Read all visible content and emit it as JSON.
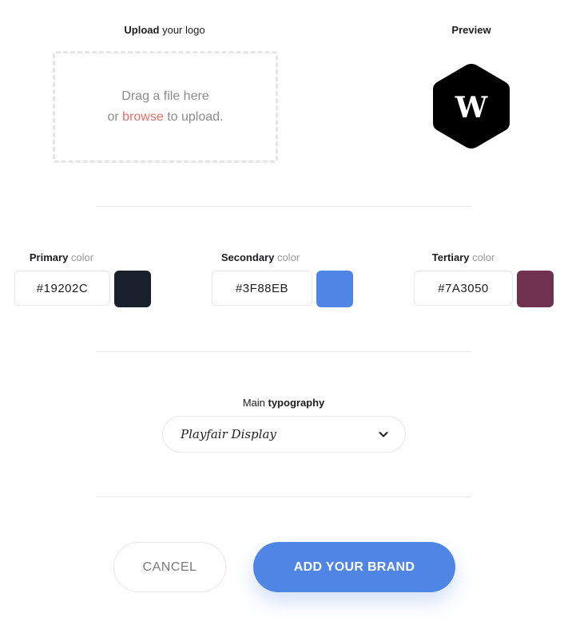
{
  "upload": {
    "title_bold": "Upload",
    "title_rest": " your logo",
    "drop_line1": "Drag a file here",
    "drop_or": "or ",
    "drop_browse": "browse",
    "drop_tail": " to upload."
  },
  "preview": {
    "title": "Preview",
    "logo_letter": "W",
    "logo_icon": "hexagon-w-logo"
  },
  "colors": {
    "primary": {
      "label_bold": "Primary",
      "label_rest": " color",
      "value": "#19202C",
      "swatch": "#19202C"
    },
    "secondary": {
      "label_bold": "Secondary",
      "label_rest": " color",
      "value": "#3F88EB",
      "swatch": "#4F86E5"
    },
    "tertiary": {
      "label_bold": "Tertiary",
      "label_rest": " color",
      "value": "#7A3050",
      "swatch": "#70304F"
    }
  },
  "typography": {
    "label_rest": "Main ",
    "label_bold": "typography",
    "selected": "Playfair Display",
    "icon": "chevron-down-icon"
  },
  "actions": {
    "cancel": "CANCEL",
    "add": "ADD YOUR BRAND",
    "accent": "#4F86E5"
  }
}
